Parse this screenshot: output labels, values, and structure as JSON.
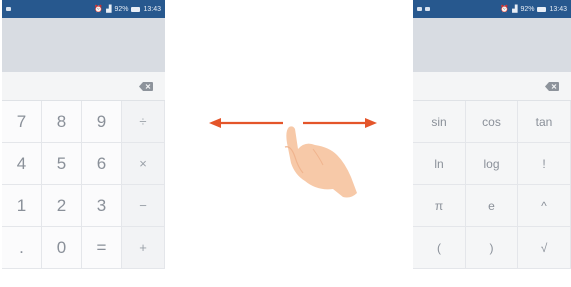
{
  "status_bar": {
    "battery": "92%",
    "time": "13:43"
  },
  "colors": {
    "status_bar": "#27588e",
    "display": "#d8dce2",
    "arrow": "#e4552a",
    "hand": "#f7c9a8"
  },
  "basic_keypad": {
    "rows": [
      [
        "7",
        "8",
        "9",
        "÷"
      ],
      [
        "4",
        "5",
        "6",
        "×"
      ],
      [
        "1",
        "2",
        "3",
        "−"
      ],
      [
        ".",
        "0",
        "=",
        "+"
      ]
    ]
  },
  "advanced_keypad": {
    "rows": [
      [
        "sin",
        "cos",
        "tan"
      ],
      [
        "ln",
        "log",
        "!"
      ],
      [
        "π",
        "e",
        "^"
      ],
      [
        "(",
        ")",
        "√"
      ]
    ]
  },
  "icons": {
    "delete": "backspace-icon",
    "gesture": "swipe-hand-icon",
    "arrows": "double-arrow-icon"
  }
}
